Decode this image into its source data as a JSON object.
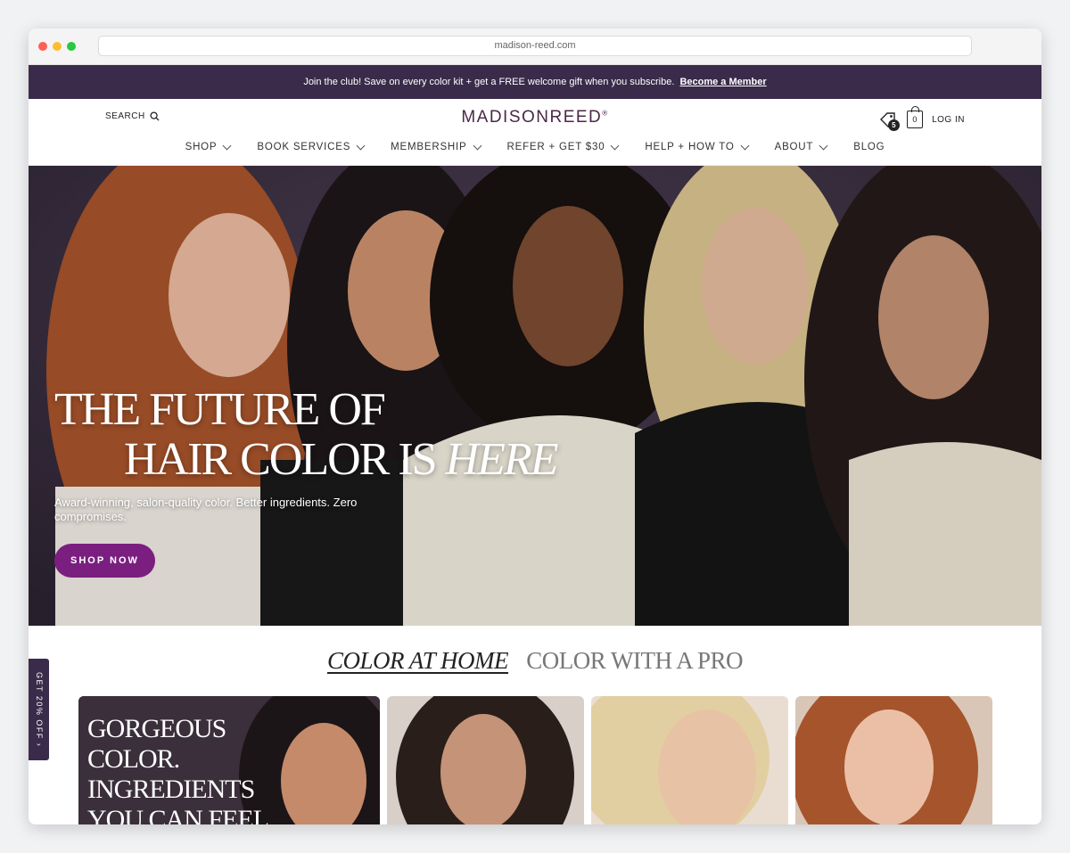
{
  "browser": {
    "url": "madison-reed.com"
  },
  "promo": {
    "text": "Join the club! Save on every color kit + get a FREE welcome gift when you subscribe.",
    "link": "Become a Member"
  },
  "header": {
    "search_label": "SEARCH",
    "logo": "MADISONREED",
    "rewards_count": "5",
    "cart_count": "0",
    "login_label": "LOG IN"
  },
  "nav": {
    "items": [
      {
        "label": "SHOP"
      },
      {
        "label": "BOOK SERVICES"
      },
      {
        "label": "MEMBERSHIP"
      },
      {
        "label": "REFER + GET $30"
      },
      {
        "label": "HELP + HOW TO"
      },
      {
        "label": "ABOUT"
      },
      {
        "label": "BLOG"
      }
    ]
  },
  "hero": {
    "line1": "THE FUTURE OF",
    "line2": "HAIR COLOR IS",
    "line2_em": "HERE",
    "subtitle": "Award-winning, salon-quality color. Better ingredients. Zero compromises.",
    "cta": "SHOP NOW"
  },
  "section": {
    "tab_active": "COLOR AT HOME",
    "tab_other": "COLOR WITH A PRO",
    "feature_title": "GORGEOUS COLOR. INGREDIENTS YOU CAN FEEL GOOD ABOUT"
  },
  "side_tab": {
    "label": "GET 20% OFF"
  },
  "colors": {
    "promo_bg": "#3a2b4a",
    "cta": "#7a1f7f",
    "logo": "#4b2747"
  }
}
